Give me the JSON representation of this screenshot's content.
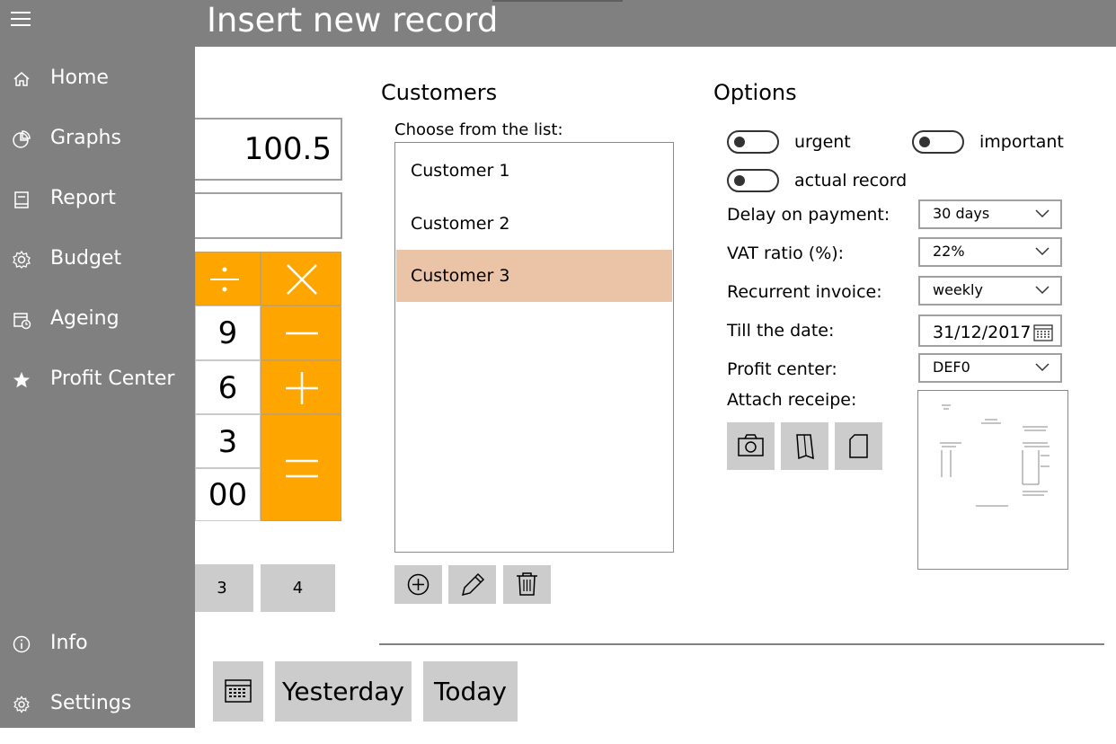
{
  "header": {
    "title": "Insert new record"
  },
  "sidebar": {
    "items": [
      {
        "label": "Home",
        "icon": "home-icon"
      },
      {
        "label": "Graphs",
        "icon": "pie-chart-icon"
      },
      {
        "label": "Report",
        "icon": "book-icon"
      },
      {
        "label": "Budget",
        "icon": "gear-icon"
      },
      {
        "label": "Ageing",
        "icon": "calendar-clock-icon"
      },
      {
        "label": "Profit Center",
        "icon": "star-icon"
      }
    ],
    "bottom_items": [
      {
        "label": "Info",
        "icon": "info-icon"
      },
      {
        "label": "Settings",
        "icon": "settings-icon"
      }
    ]
  },
  "entry": {
    "amount": "100.5",
    "note": ""
  },
  "calculator": {
    "divide": "÷",
    "multiply": "×",
    "minus": "−",
    "plus": "+",
    "equals": "=",
    "nine": "9",
    "six": "6",
    "three": "3",
    "double_zero": "00"
  },
  "pager": {
    "page3": "3",
    "page4": "4"
  },
  "customers": {
    "heading": "Customers",
    "prompt": "Choose from the list:",
    "items": [
      "Customer 1",
      "Customer 2",
      "Customer 3"
    ],
    "selected": "Customer 3"
  },
  "options": {
    "heading": "Options",
    "toggles": {
      "urgent": "urgent",
      "important": "important",
      "actual": "actual record"
    },
    "delay": {
      "label": "Delay on payment:",
      "value": "30 days"
    },
    "vat": {
      "label": "VAT ratio (%):",
      "value": "22%"
    },
    "recurrent": {
      "label": "Recurrent invoice:",
      "value": "weekly"
    },
    "till": {
      "label": "Till the date:",
      "value": "31/12/2017"
    },
    "profit": {
      "label": "Profit center:",
      "value": "DEF0"
    },
    "attach": {
      "label": "Attach receipe:"
    }
  },
  "dates": {
    "yesterday": "Yesterday",
    "today": "Today"
  },
  "colors": {
    "sidebar": "#808080",
    "operator": "#ffa500",
    "selected_row": "#ebc4a8",
    "chip": "#cccccc"
  }
}
